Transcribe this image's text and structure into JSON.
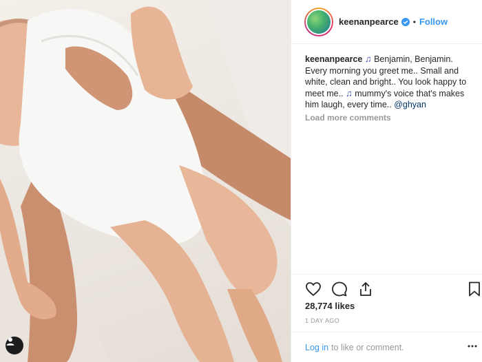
{
  "post": {
    "username": "keenanpearce",
    "follow_label": "Follow",
    "separator": "•",
    "caption": {
      "username": "keenanpearce",
      "note_icon_1": "♫",
      "part1": " Benjamin, Benjamin. Every morning you greet me.. Small and white, clean and bright.. You look happy to meet me.. ",
      "note_icon_2": "♫",
      "part2": " mummy's voice that's makes him laugh, every time.. ",
      "mention": "@ghyan"
    },
    "load_more": "Load more comments",
    "likes": "28,774 likes",
    "date": "1 DAY AGO",
    "login_link": "Log in",
    "login_rest": "to like or comment."
  },
  "icons": {
    "like": "heart-icon",
    "comment": "comment-icon",
    "share": "share-icon",
    "save": "bookmark-icon",
    "more": "more-dots-icon",
    "verified": "verified-badge-icon",
    "tag": "user-tag-icon"
  },
  "colors": {
    "link_blue": "#3897f0",
    "muted": "#999999",
    "text": "#262626",
    "border": "#efefef"
  }
}
